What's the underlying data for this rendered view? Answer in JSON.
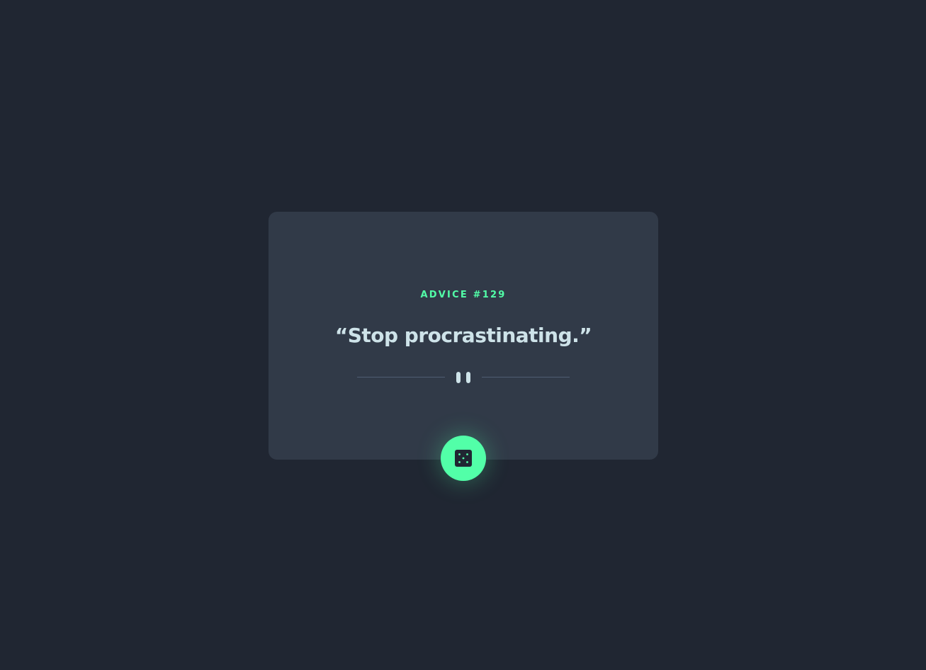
{
  "advice": {
    "id_label": "ADVICE #129",
    "quote": "“Stop procrastinating.”"
  },
  "icons": {
    "divider": "pause-icon",
    "button": "dice-icon"
  },
  "colors": {
    "background": "#202632",
    "card": "#313a48",
    "accent": "#52ffa8",
    "text": "#cee3e9",
    "divider": "#4f5d74"
  }
}
